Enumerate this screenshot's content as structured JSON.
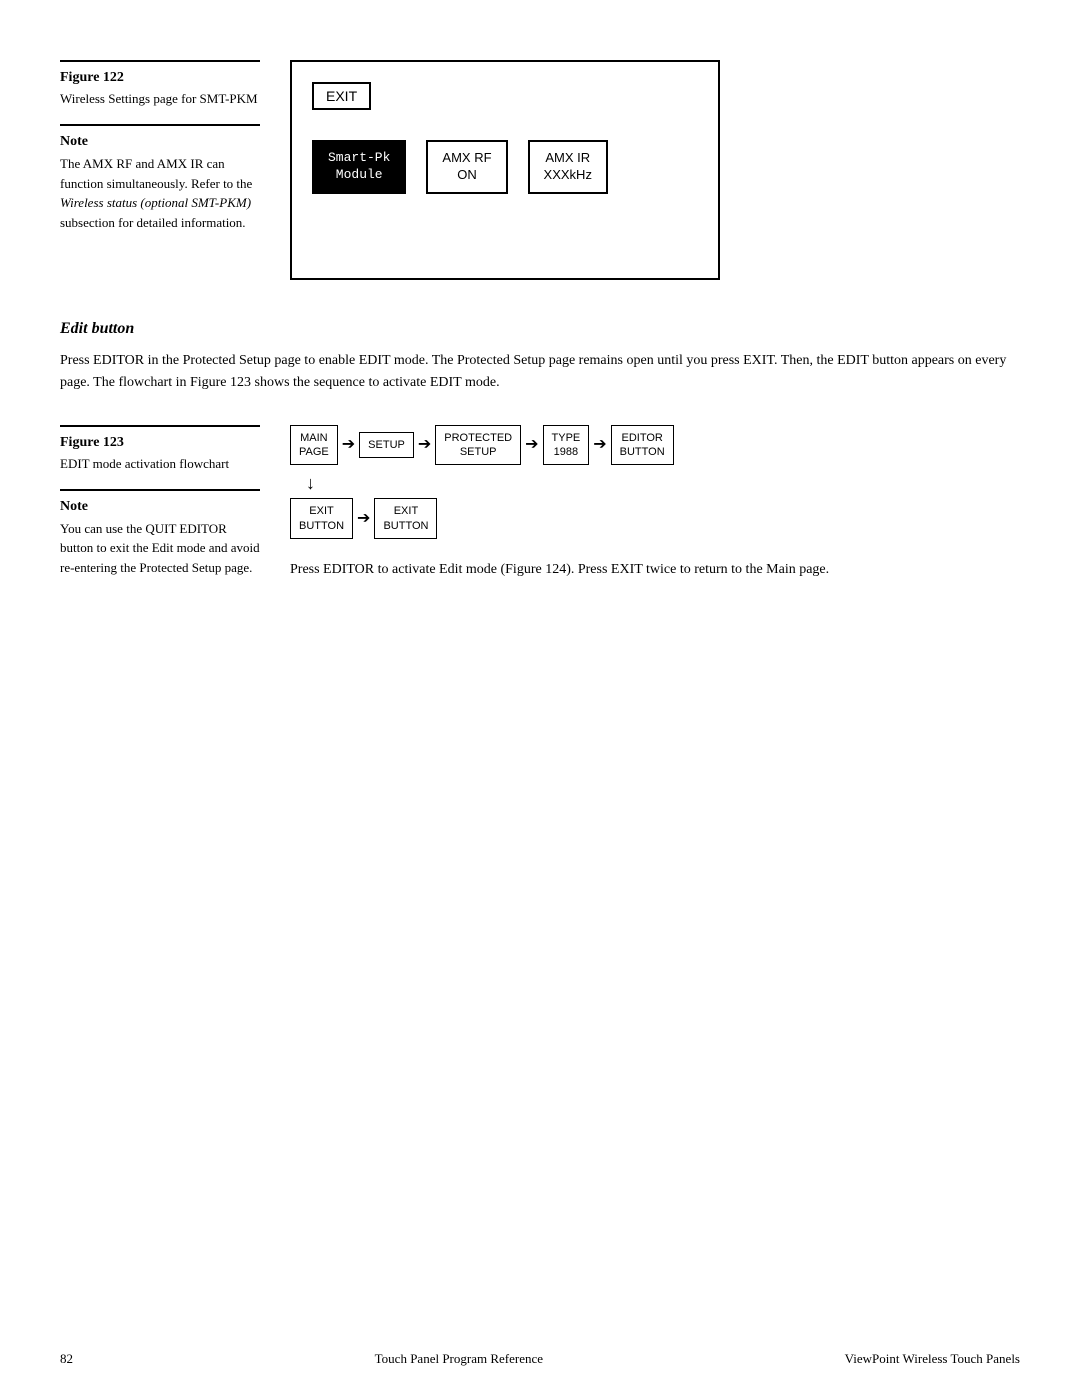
{
  "page": {
    "footer_left": "82",
    "footer_center": "Touch Panel Program Reference",
    "footer_right": "ViewPoint Wireless Touch Panels"
  },
  "figure122": {
    "label": "Figure 122",
    "caption": "Wireless Settings page for SMT-PKM"
  },
  "note1": {
    "label": "Note",
    "text_line1": "The AMX RF and AMX IR can function simultaneously. Refer to the ",
    "text_italic": "Wireless status (optional SMT-PKM)",
    "text_line2": " subsection for detailed information."
  },
  "wireless_diagram": {
    "exit_label": "EXIT",
    "smart_pk_line1": "Smart-Pk",
    "smart_pk_line2": "Module",
    "amx_rf_line1": "AMX RF",
    "amx_rf_line2": "ON",
    "amx_ir_line1": "AMX IR",
    "amx_ir_line2": "XXXkHz"
  },
  "edit_button_section": {
    "title": "Edit button",
    "body_text": "Press EDITOR in the Protected Setup page to enable EDIT mode. The Protected Setup page remains open until you press EXIT. Then, the EDIT button appears on every page. The flowchart in Figure 123 shows the sequence to activate EDIT mode."
  },
  "figure123": {
    "label": "Figure 123",
    "caption": "EDIT mode activation flowchart"
  },
  "note2": {
    "label": "Note",
    "text": "You can use the QUIT EDITOR button to exit the Edit mode and avoid re-entering the Protected Setup page."
  },
  "flowchart": {
    "main_page": "MAIN\nPAGE",
    "setup": "SETUP",
    "protected_setup": "PROTECTED\nSETUP",
    "type_1988": "TYPE\n1988",
    "editor_button": "EDITOR\nBUTTON",
    "exit_button1": "EXIT\nBUTTON",
    "exit_button2": "EXIT\nBUTTON"
  },
  "press_editor_text": "Press EDITOR to activate Edit mode (Figure 124). Press EXIT twice to return to the Main page."
}
